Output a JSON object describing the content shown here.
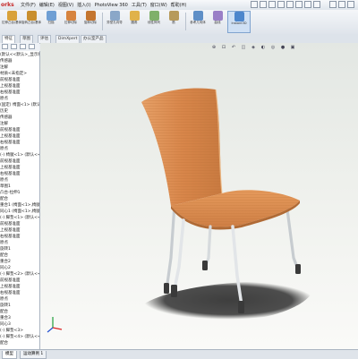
{
  "menubar": {
    "brand": "orks",
    "items": [
      "文件(F)",
      "编辑(E)",
      "视图(V)",
      "插入(I)",
      "PhotoView 360",
      "工具(T)",
      "窗口(W)",
      "帮助(H)"
    ]
  },
  "ribbon": {
    "buttons": [
      {
        "label": "拉伸凸台/基体",
        "color": "#d9a23a"
      },
      {
        "label": "旋转凸台/基体",
        "color": "#c98f2e"
      },
      {
        "label": "扫描",
        "color": "#6f9fd4"
      },
      {
        "label": "拉伸切除",
        "color": "#d7843f"
      },
      {
        "label": "旋转切除",
        "color": "#c4752f"
      },
      {
        "label": "异型孔向导",
        "color": "#8aa7c8"
      },
      {
        "label": "圆角",
        "color": "#e0b24a"
      },
      {
        "label": "线性阵列",
        "color": "#7fb06a"
      },
      {
        "label": "筋",
        "color": "#b79a5a"
      },
      {
        "label": "参考几何体",
        "color": "#5f8fc7"
      },
      {
        "label": "曲线",
        "color": "#9a7fc7"
      },
      {
        "label": "Instant3D",
        "color": "#4c86cc"
      }
    ]
  },
  "tabs": [
    "特征",
    "草图",
    "评估",
    "DimXpert",
    "办公室产品"
  ],
  "tree": {
    "items": [
      "(默认<<默认>_显示状态",
      "传感器",
      "注解",
      "材质<未指定>",
      "前视基准面",
      "上视基准面",
      "右视基准面",
      "原点",
      "(固定) 椅面<1> (默认<<默认>...",
      "历史",
      "传感器",
      "注解",
      "前视基准面",
      "上视基准面",
      "右视基准面",
      "原点",
      "(-) 椅腿<1> (默认<<默认>...",
      "前视基准面",
      "上视基准面",
      "右视基准面",
      "原点",
      "草图1",
      "凸台-拉伸1",
      "配合",
      "重合1 (椅面<1>,椅腿<1>)",
      "同心1 (椅面<1>,椅腿<1>)",
      "(-) 脚垫<1> (默认<<默认>...",
      "前视基准面",
      "上视基准面",
      "右视基准面",
      "原点",
      "旋转1",
      "配合",
      "重合2",
      "同心2",
      "(-) 脚垫<2> (默认<<默认>...",
      "前视基准面",
      "上视基准面",
      "右视基准面",
      "原点",
      "旋转1",
      "配合",
      "重合3",
      "同心3",
      "(-) 脚垫<3>",
      "(-) 脚垫<4> (默认<<默认>...",
      "配合"
    ]
  },
  "statusbar": {
    "tabs": [
      "模型",
      "运动算例 1"
    ]
  },
  "colors": {
    "wood": "#d8864a",
    "leg": "#d9dde0",
    "foot": "#3a3a3a",
    "shadow": "#2f2f2f"
  }
}
